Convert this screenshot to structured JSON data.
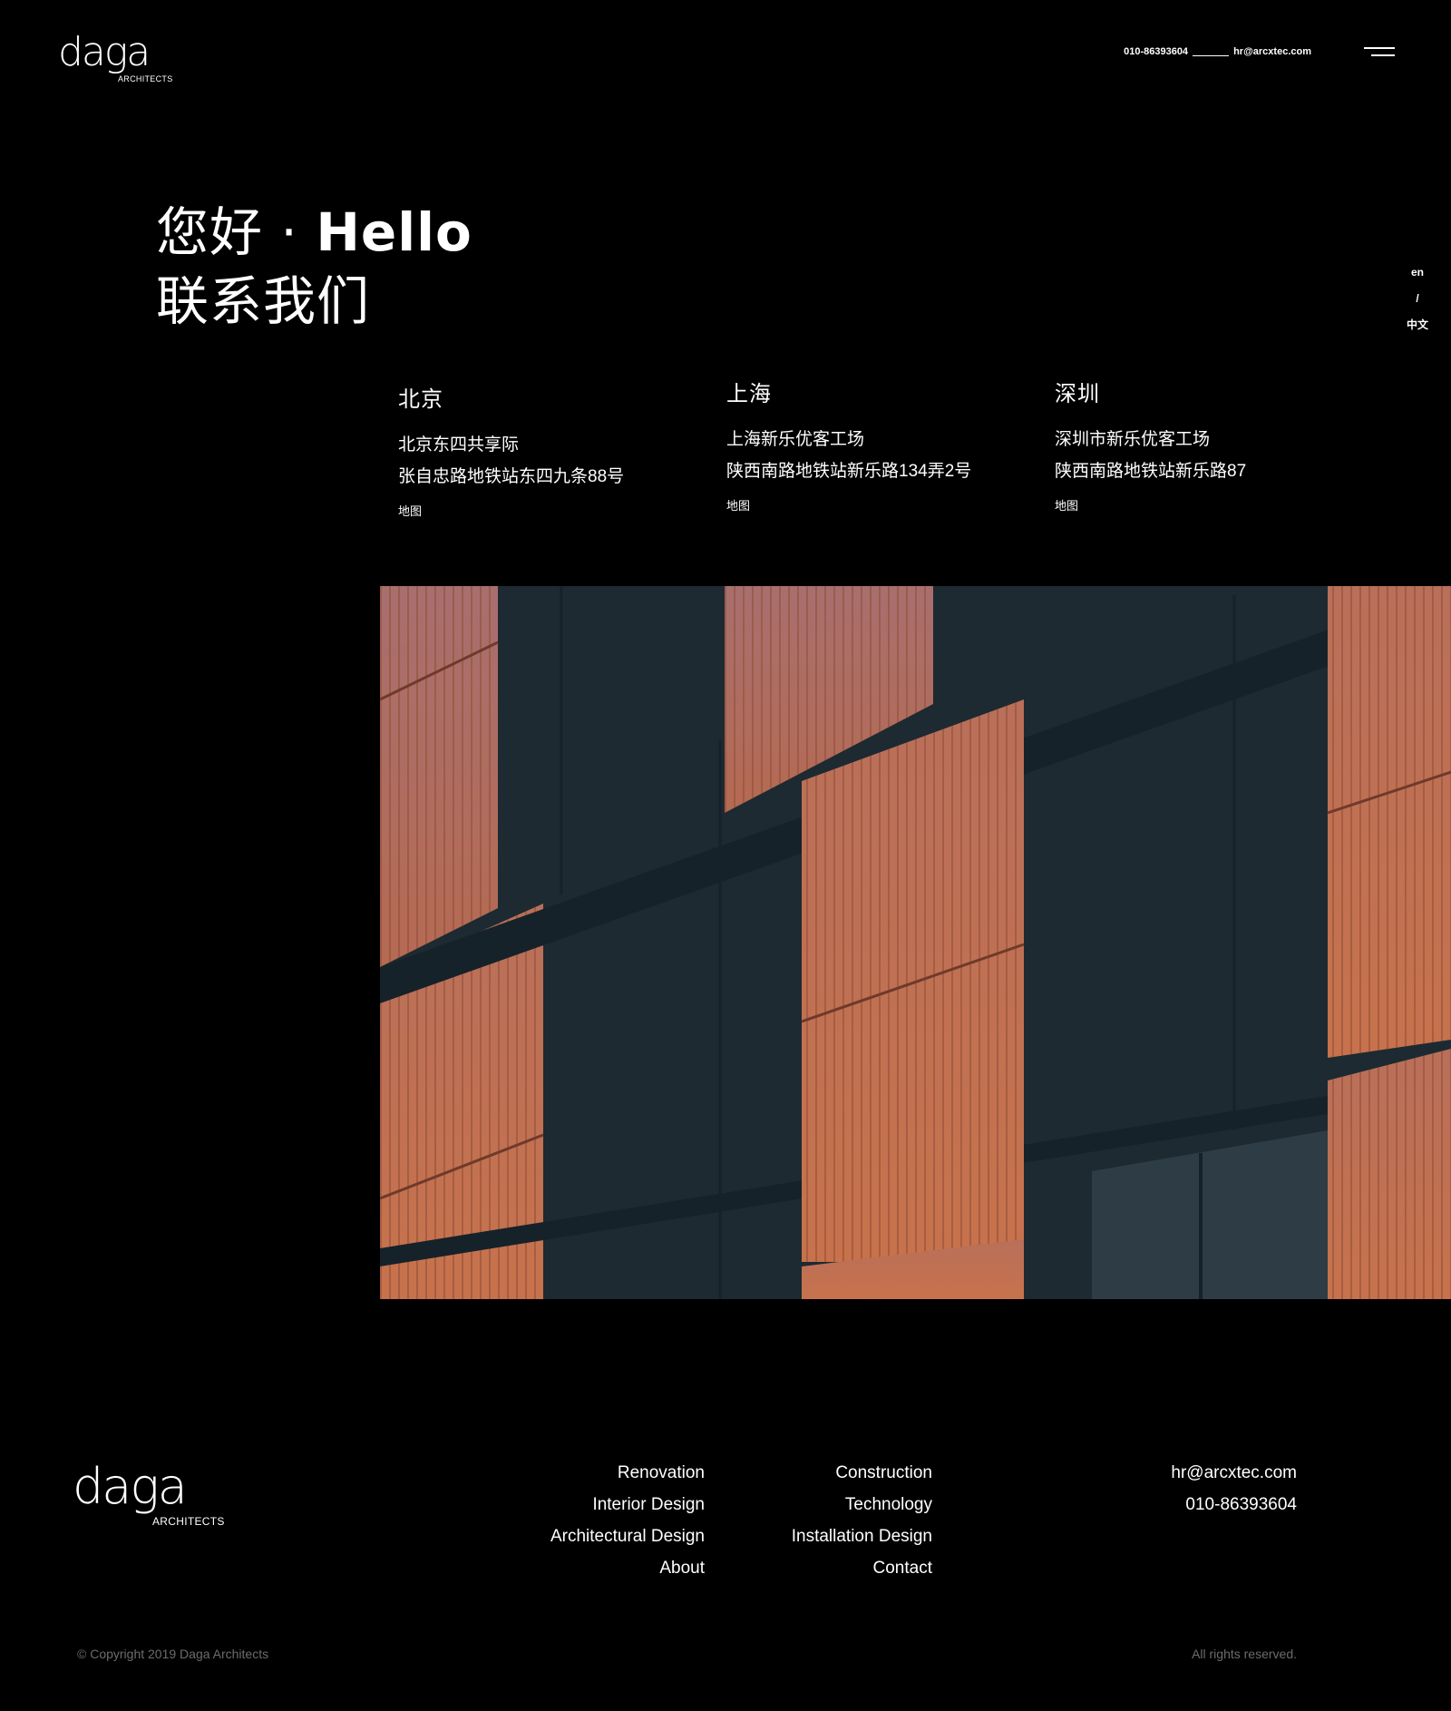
{
  "header": {
    "logo_word": "daga",
    "logo_sub": "ARCHITECTS",
    "phone": "010-86393604",
    "email": "hr@arcxtec.com",
    "menu_icon": "hamburger-menu-icon"
  },
  "hero": {
    "line1_cn": "您好 · ",
    "line1_en": "Hello",
    "line2": "联系我们"
  },
  "language": {
    "en": "en",
    "separator": "/",
    "cn": "中文"
  },
  "offices": [
    {
      "city": "北京",
      "address_line1": "北京东四共享际",
      "address_line2": "张自忠路地铁站东四九条88号",
      "map_label": "地图"
    },
    {
      "city": "上海",
      "address_line1": "上海新乐优客工场",
      "address_line2": "陕西南路地铁站新乐路134弄2号",
      "map_label": "地图"
    },
    {
      "city": "深圳",
      "address_line1": "深圳市新乐优客工场",
      "address_line2": "陕西南路地铁站新乐路87",
      "map_label": "地图"
    }
  ],
  "footer": {
    "logo_word": "daga",
    "logo_sub": "ARCHITECTS",
    "column1": [
      "Renovation",
      "Interior Design",
      "Architectural Design",
      "About"
    ],
    "column2": [
      "Construction",
      "Technology",
      "Installation Design",
      "Contact"
    ],
    "email": "hr@arcxtec.com",
    "phone": "010-86393604",
    "copyright": "© Copyright 2019 Daga Architects",
    "rights": "All rights reserved."
  },
  "colors": {
    "background": "#000000",
    "text": "#ffffff",
    "muted": "#6c6c6c",
    "facade_dark": "#1d2a31",
    "facade_orange": "#c4714e"
  }
}
